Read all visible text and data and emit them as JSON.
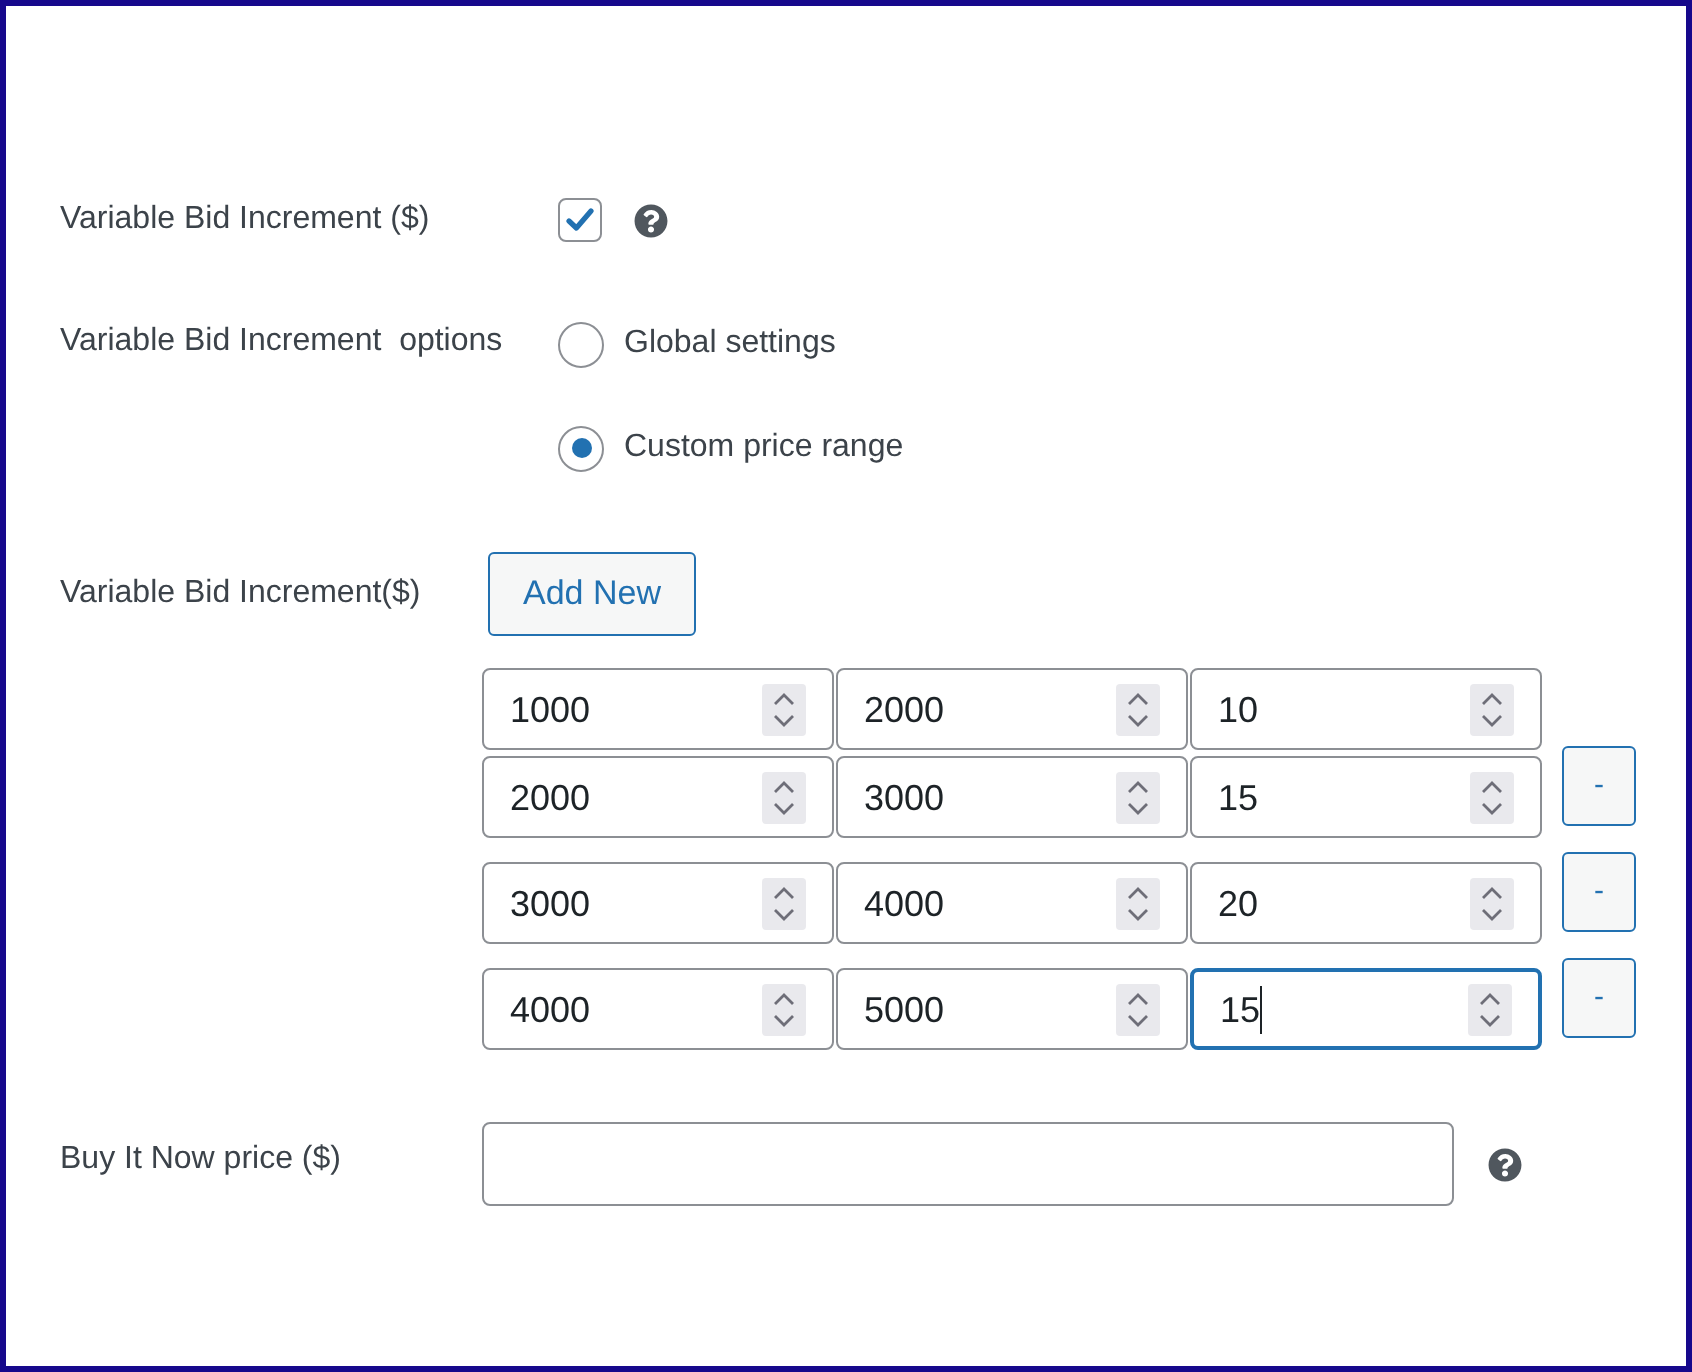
{
  "bid_increment": {
    "label": "Variable Bid Increment ($)",
    "checked": true
  },
  "increment_options": {
    "label": "Variable Bid Increment  options",
    "options": [
      {
        "label": "Global settings",
        "selected": false
      },
      {
        "label": "Custom price range",
        "selected": true
      }
    ]
  },
  "price_ranges": {
    "label": "Variable Bid Increment($)",
    "add_button": "Add New",
    "rows": [
      {
        "cells": [
          {
            "value": "1000",
            "focused": false
          },
          {
            "value": "2000",
            "focused": false
          },
          {
            "value": "10",
            "focused": false
          }
        ]
      },
      {
        "cells": [
          {
            "value": "2000",
            "focused": false
          },
          {
            "value": "3000",
            "focused": false
          },
          {
            "value": "15",
            "focused": false
          }
        ],
        "remove_button": "-"
      },
      {
        "cells": [
          {
            "value": "3000",
            "focused": false
          },
          {
            "value": "4000",
            "focused": false
          },
          {
            "value": "20",
            "focused": false
          }
        ],
        "remove_button": "-"
      },
      {
        "cells": [
          {
            "value": "4000",
            "focused": false
          },
          {
            "value": "5000",
            "focused": false
          },
          {
            "value": "15",
            "focused": true
          }
        ],
        "remove_button": "-"
      }
    ]
  },
  "buy_now": {
    "label": "Buy It Now price ($)"
  }
}
